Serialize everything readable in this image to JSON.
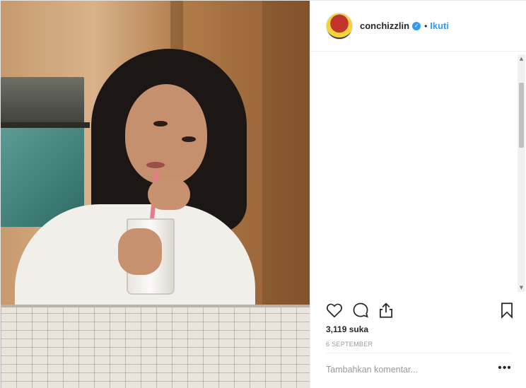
{
  "post": {
    "username": "conchizzlin",
    "separator": "•",
    "follow_label": "Ikuti",
    "verified_icon": "verified-badge-icon",
    "likes_text": "3,119 suka",
    "date_text": "6 SEPTEMBER",
    "comment_placeholder": "Tambahkan komentar...",
    "more_label": "•••"
  },
  "scrollbar": {
    "up_glyph": "▲",
    "down_glyph": "▼"
  },
  "icons": {
    "like": "heart-icon",
    "comment": "comment-icon",
    "share": "share-icon",
    "save": "bookmark-icon"
  },
  "colors": {
    "accent": "#3897f0",
    "text": "#262626",
    "muted": "#999999",
    "border": "#efefef"
  }
}
